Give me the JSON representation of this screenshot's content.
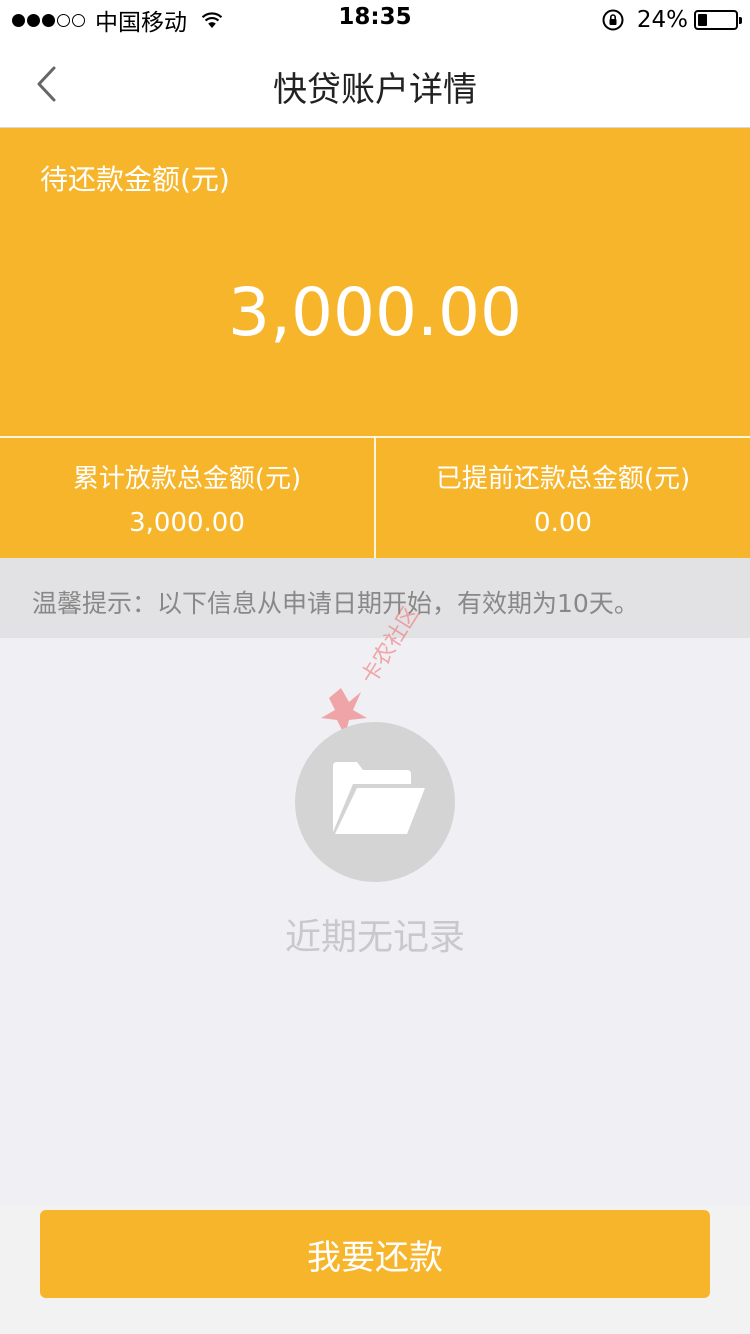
{
  "status_bar": {
    "carrier": "中国移动",
    "time": "18:35",
    "battery_percent": "24%",
    "battery_level": 0.24,
    "signal_bars_filled": 3,
    "signal_bars_total": 5
  },
  "nav": {
    "title": "快贷账户详情"
  },
  "hero": {
    "label": "待还款金额(元)",
    "amount": "3,000.00"
  },
  "stats": [
    {
      "label": "累计放款总金额(元)",
      "value": "3,000.00"
    },
    {
      "label": "已提前还款总金额(元)",
      "value": "0.00"
    }
  ],
  "tip": {
    "text": "温馨提示：以下信息从申请日期开始，有效期为10天。"
  },
  "empty_state": {
    "icon": "folder-icon",
    "text": "近期无记录"
  },
  "watermark": {
    "text": "卡农社区"
  },
  "actions": {
    "repay_label": "我要还款"
  },
  "colors": {
    "accent": "#f7b52c",
    "background": "#efeff4",
    "tip_background": "#e2e2e4"
  }
}
